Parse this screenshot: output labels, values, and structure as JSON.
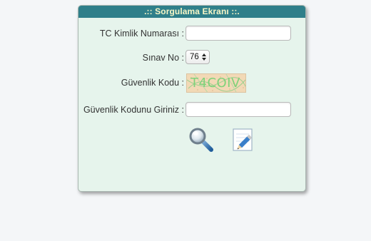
{
  "header": {
    "title": ".:: Sorgulama Ekranı ::."
  },
  "form": {
    "tc_label": "TC Kimlik Numarası :",
    "tc_value": "",
    "sinav_label": "Sınav No :",
    "sinav_value": "76",
    "guvenlik_label": "Güvenlik Kodu :",
    "captcha_text": "T4COIV",
    "guvenlik_input_label": "Güvenlik Kodunu Giriniz :",
    "guvenlik_input_value": ""
  },
  "actions": {
    "search_icon": "magnifier-icon",
    "edit_icon": "pencil-edit-icon"
  },
  "colors": {
    "header_bg": "#2f7f8a",
    "header_text": "#f6f6c6",
    "panel_bg": "#e6f4ec",
    "captcha_bg": "#f2d9b6",
    "captcha_text": "#7fd27a"
  }
}
